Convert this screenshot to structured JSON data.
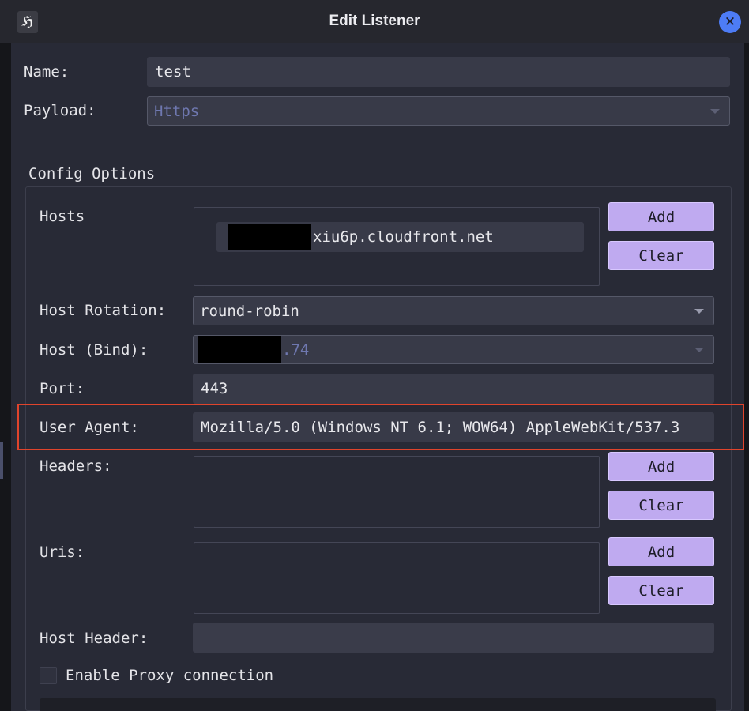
{
  "window": {
    "title": "Edit Listener",
    "app_icon_glyph": "ℌ",
    "close_glyph": "✕",
    "accent_color": "#4d7cf5"
  },
  "form": {
    "name_label": "Name:",
    "name_value": "test",
    "payload_label": "Payload:",
    "payload_value": "Https"
  },
  "config": {
    "title": "Config Options",
    "hosts_label": "Hosts",
    "hosts_entry_suffix": "xiu6p.cloudfront.net",
    "hosts_add": "Add",
    "hosts_clear": "Clear",
    "host_rotation_label": "Host Rotation:",
    "host_rotation_value": "round-robin",
    "host_bind_label": "Host (Bind):",
    "host_bind_suffix": ".74",
    "port_label": "Port:",
    "port_value": "443",
    "user_agent_label": "User Agent:",
    "user_agent_value": "Mozilla/5.0 (Windows NT 6.1; WOW64) AppleWebKit/537.3",
    "headers_label": "Headers:",
    "headers_add": "Add",
    "headers_clear": "Clear",
    "uris_label": "Uris:",
    "uris_add": "Add",
    "uris_clear": "Clear",
    "host_header_label": "Host Header:",
    "host_header_value": "",
    "proxy_label": "Enable Proxy connection"
  },
  "highlight_color": "#e0442c"
}
